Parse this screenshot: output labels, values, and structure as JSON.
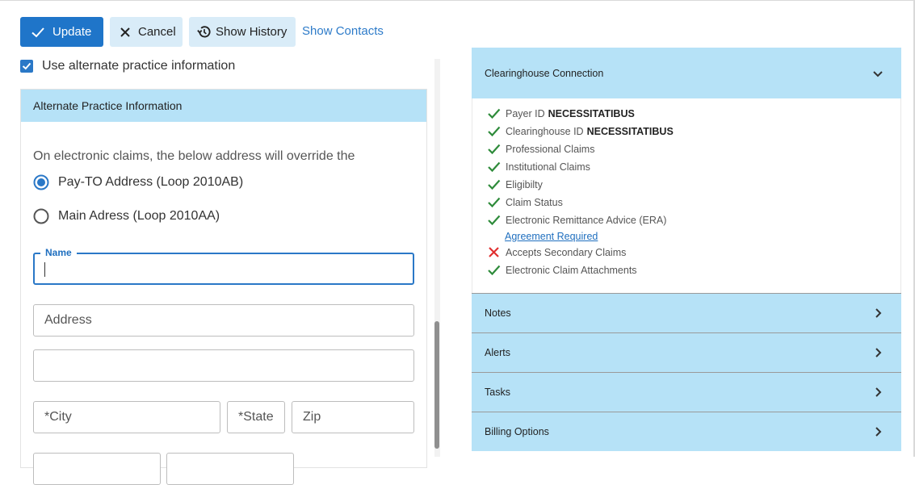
{
  "toolbar": {
    "update_label": "Update",
    "cancel_label": "Cancel",
    "history_label": "Show History",
    "contacts_label": "Show Contacts"
  },
  "left": {
    "alt_checkbox_label": "Use alternate practice information",
    "alt_checkbox_checked": true,
    "card_title": "Alternate Practice Information",
    "override_text": "On electronic claims, the below address will override the",
    "radio_payto": "Pay-TO Address (Loop 2010AB)",
    "radio_main": "Main Adress (Loop 2010AA)",
    "selected_radio": "payto",
    "name_label": "Name",
    "name_value": "",
    "address_placeholder": "Address",
    "address2_placeholder": "",
    "city_placeholder": "*City",
    "state_placeholder": "*State",
    "zip_placeholder": "Zip"
  },
  "right": {
    "clearinghouse_title": "Clearinghouse Connection",
    "items": [
      {
        "label": "Payer ID",
        "value": "NECESSITATIBUS",
        "status": "ok"
      },
      {
        "label": "Clearinghouse ID",
        "value": "NECESSITATIBUS",
        "status": "ok"
      },
      {
        "label": "Professional Claims",
        "value": "",
        "status": "ok"
      },
      {
        "label": "Institutional Claims",
        "value": "",
        "status": "ok"
      },
      {
        "label": "Eligibilty",
        "value": "",
        "status": "ok"
      },
      {
        "label": "Claim Status",
        "value": "",
        "status": "ok"
      },
      {
        "label": "Electronic Remittance Advice (ERA)",
        "value": "",
        "status": "ok"
      },
      {
        "label": "Accepts Secondary Claims",
        "value": "",
        "status": "fail"
      },
      {
        "label": "Electronic Claim Attachments",
        "value": "",
        "status": "ok"
      }
    ],
    "agreement_link": "Agreement Required",
    "notes_title": "Notes",
    "alerts_title": "Alerts",
    "tasks_title": "Tasks",
    "billing_title": "Billing Options"
  },
  "colors": {
    "primary": "#1f75c9",
    "secondary_bg": "#d9ecf8",
    "panel_header": "#b6e2f7",
    "check_ok": "#2e8b3a",
    "check_fail": "#e03030"
  }
}
